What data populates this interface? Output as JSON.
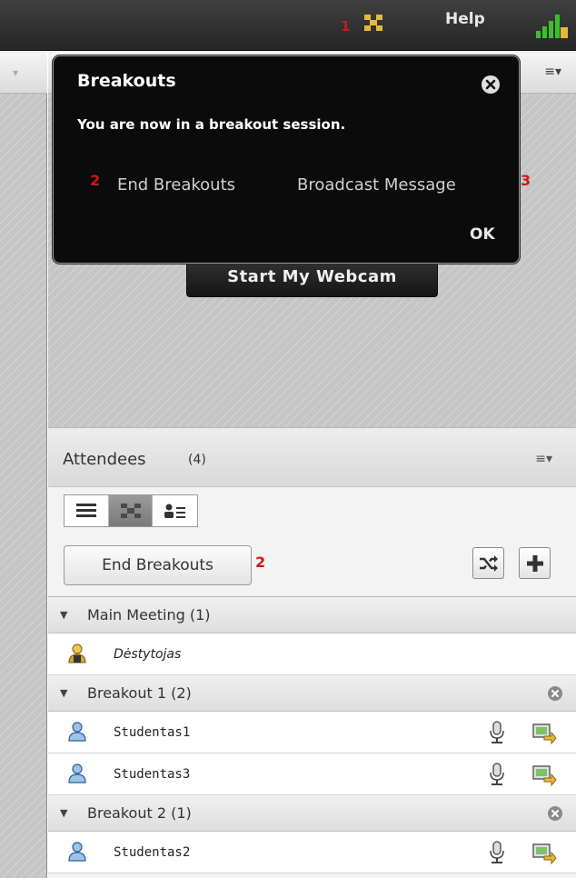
{
  "topbar": {
    "breakout_number": "1",
    "help_label": "Help"
  },
  "popup": {
    "title": "Breakouts",
    "message": "You are now in a breakout session.",
    "end_number": "2",
    "end_label": "End Breakouts",
    "broadcast_label": "Broadcast Message",
    "broadcast_number": "3",
    "ok_label": "OK"
  },
  "video": {
    "webcam_label": "Start My Webcam"
  },
  "attendees": {
    "title": "Attendees",
    "count": "(4)",
    "end_breakouts_label": "End Breakouts",
    "end_breakouts_number": "2",
    "groups": [
      {
        "label": "Main Meeting (1)",
        "closable": false,
        "members": [
          {
            "name": "Dėstytojas",
            "role": "host"
          }
        ]
      },
      {
        "label": "Breakout 1 (2)",
        "closable": true,
        "members": [
          {
            "name": "Studentas1",
            "role": "participant"
          },
          {
            "name": "Studentas3",
            "role": "participant"
          }
        ]
      },
      {
        "label": "Breakout 2 (1)",
        "closable": true,
        "members": [
          {
            "name": "Studentas2",
            "role": "participant"
          }
        ]
      }
    ]
  },
  "icons": {
    "breakout": "breakout-icon",
    "signal": "signal-strength-icon",
    "close": "close-circle-icon",
    "pod_menu": "menu-icon",
    "list_view": "list-view-icon",
    "breakout_view": "breakout-view-icon",
    "attendee_view": "attendee-view-icon",
    "shuffle": "shuffle-icon",
    "add": "plus-icon",
    "mic": "microphone-icon",
    "share": "screen-share-icon"
  },
  "colors": {
    "annotation_red": "#c91a1a",
    "popup_bg": "#0b0b0b",
    "breakout_icon": "#e8b83a",
    "signal_green": "#3bbf2a"
  }
}
